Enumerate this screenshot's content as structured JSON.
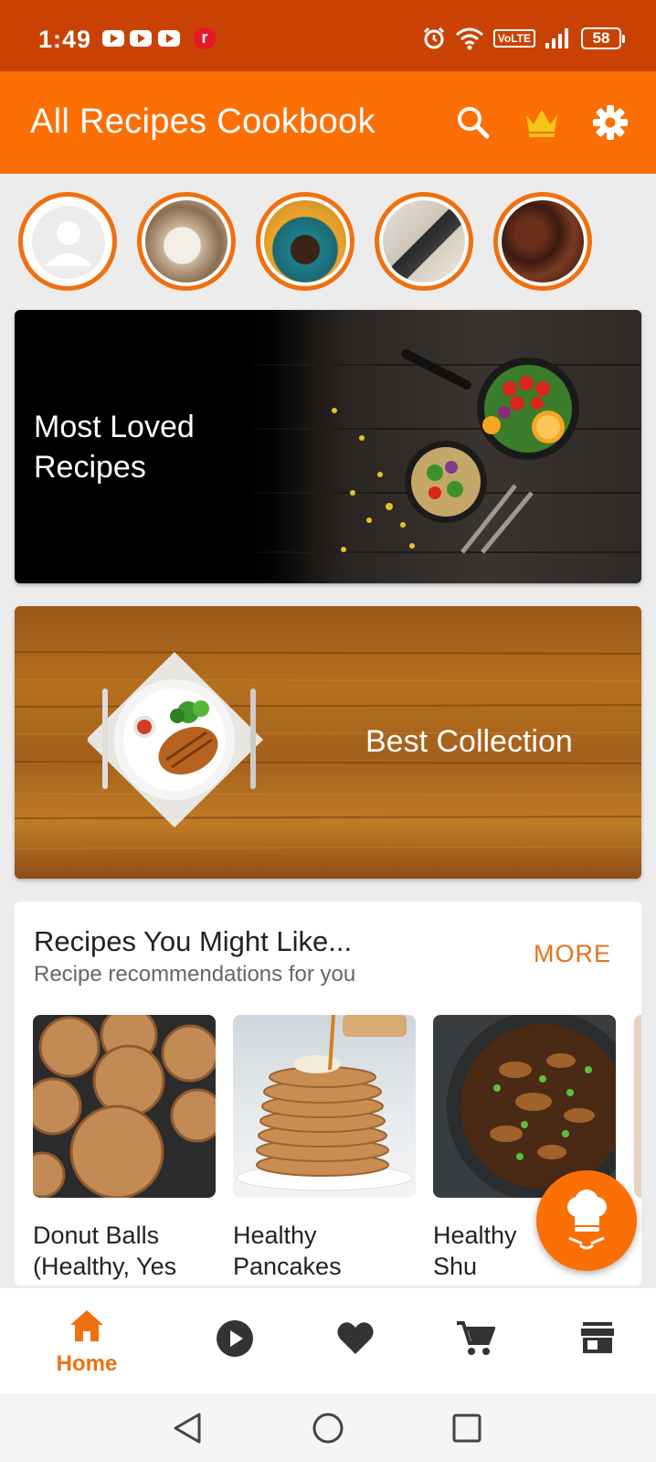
{
  "status_bar": {
    "time": "1:49",
    "battery": "58",
    "volte": "VoLTE"
  },
  "app_bar": {
    "title": "All Recipes Cookbook",
    "icons": [
      "search-icon",
      "crown-icon",
      "gear-icon"
    ]
  },
  "stories": [
    "profile-avatar",
    "story-plated-dish",
    "story-chocolate-cake",
    "story-phone-photo",
    "story-grilled-meat"
  ],
  "banners": {
    "most_loved": "Most Loved\nRecipes",
    "best_collection": "Best Collection"
  },
  "recommendations": {
    "title": "Recipes You Might Like...",
    "subtitle": "Recipe recommendations for you",
    "more_label": "MORE",
    "items": [
      {
        "name": "Donut Balls\n(Healthy, Yes"
      },
      {
        "name": "Healthy\nPancakes"
      },
      {
        "name": "Healthy\nShu"
      }
    ]
  },
  "bottom_nav": {
    "home_label": "Home",
    "items": [
      "home-icon",
      "play-icon",
      "heart-icon",
      "cart-icon",
      "store-icon"
    ]
  },
  "colors": {
    "primary": "#fb6f05",
    "status_bar": "#c94204",
    "accent_text": "#e8711a"
  }
}
